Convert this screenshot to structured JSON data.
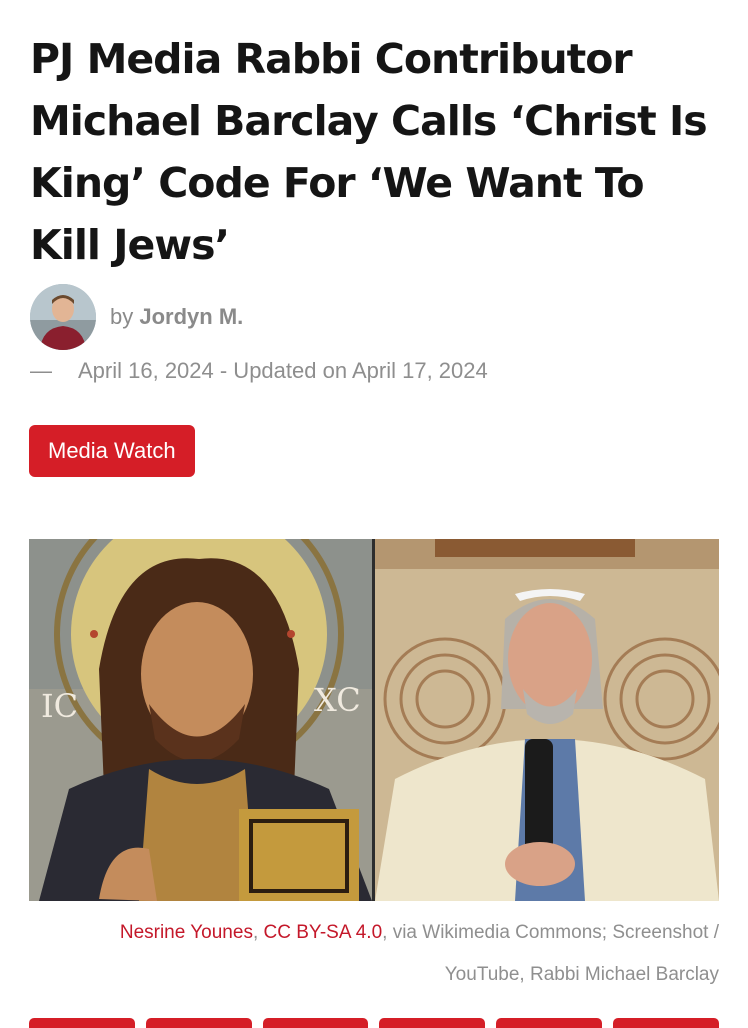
{
  "article": {
    "title": "PJ Media Rabbi Contributor Michael Barclay Calls ‘Christ Is King’ Code For ‘We Want To Kill Jews’",
    "byline_prefix": "by",
    "author": "Jordyn M.",
    "date_dash": "—",
    "date": "April 16, 2024 - Updated on April 17, 2024",
    "category": "Media Watch"
  },
  "image": {
    "left_panel": "icon-christ-pantocrator",
    "right_panel": "photo-rabbi-speaking",
    "icon_letters_left": "IC",
    "icon_letters_right": "XC"
  },
  "caption": {
    "link1": "Nesrine Younes",
    "sep1": ", ",
    "link2": "CC BY-SA 4.0",
    "rest": ", via Wikimedia Commons; Screenshot / YouTube, Rabbi Michael Barclay"
  },
  "colors": {
    "accent": "#d51e27",
    "link": "#c4182a",
    "meta_text": "#8e8e8e"
  }
}
